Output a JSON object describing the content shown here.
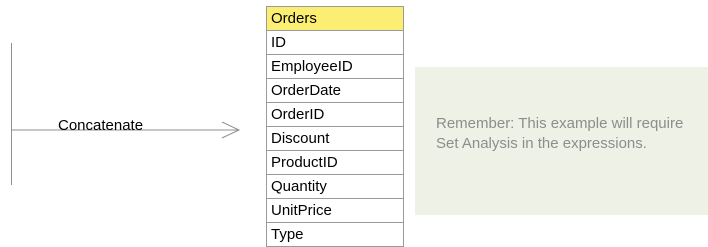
{
  "concatenate_label": "Concatenate",
  "table": {
    "header": "Orders",
    "fields": [
      "ID",
      "EmployeeID",
      "OrderDate",
      "OrderID",
      "Discount",
      "ProductID",
      "Quantity",
      "UnitPrice",
      "Type"
    ]
  },
  "note": {
    "text": "Remember: This example will require Set Analysis in the expressions."
  },
  "colors": {
    "header_fill": "#fbee73",
    "note_fill": "#eef1e6",
    "note_text": "#8d8d8d",
    "lines": "#909090"
  }
}
